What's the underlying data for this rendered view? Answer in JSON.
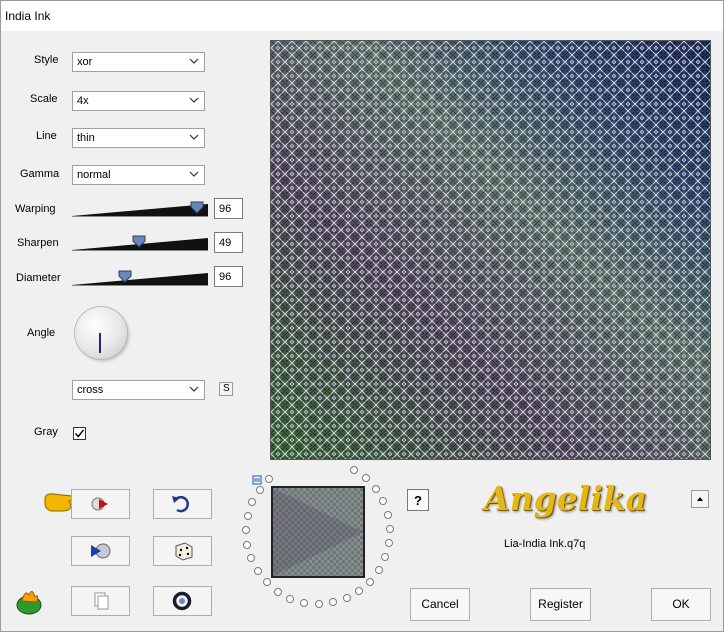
{
  "window": {
    "title": "India Ink"
  },
  "controls": {
    "style": {
      "label": "Style",
      "value": "xor"
    },
    "scale": {
      "label": "Scale",
      "value": "4x"
    },
    "line": {
      "label": "Line",
      "value": "thin"
    },
    "gamma": {
      "label": "Gamma",
      "value": "normal"
    },
    "warping": {
      "label": "Warping",
      "value": "96",
      "fraction": 0.96
    },
    "sharpen": {
      "label": "Sharpen",
      "value": "49",
      "fraction": 0.49
    },
    "diameter": {
      "label": "Diameter",
      "value": "96",
      "fraction": 0.38
    },
    "angle": {
      "label": "Angle"
    },
    "angle_mode": {
      "value": "cross"
    },
    "s_button": {
      "label": "S"
    },
    "gray": {
      "label": "Gray",
      "checked": true
    }
  },
  "footer": {
    "help_label": "?",
    "logo_text": "Angelika",
    "filename": "Lia-India Ink.q7q",
    "cancel_label": "Cancel",
    "register_label": "Register",
    "ok_label": "OK"
  },
  "icons": {
    "preset": "pointing-hand-icon",
    "play": "play-icon",
    "undo": "undo-icon",
    "media": "media-icon",
    "random": "dice-icon",
    "copy": "copy-icon",
    "reset": "ring-icon",
    "app": "flame-icon"
  }
}
